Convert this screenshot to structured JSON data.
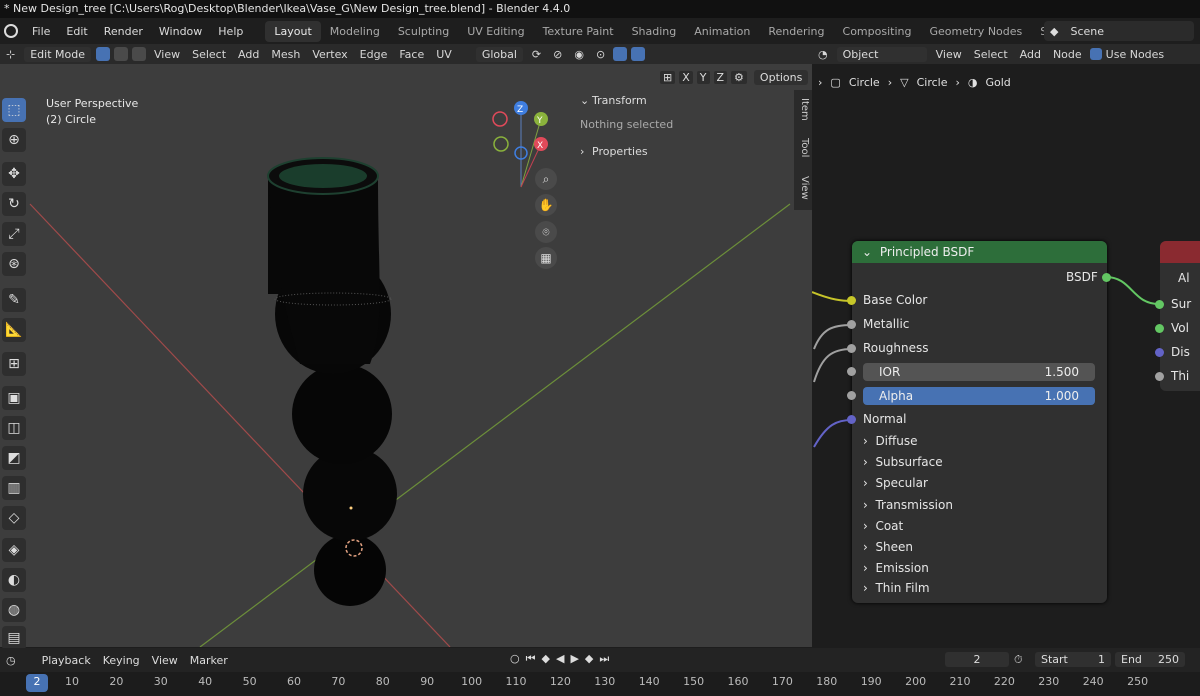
{
  "window": {
    "title": "* New Design_tree [C:\\Users\\Rog\\Desktop\\Blender\\Ikea\\Vase_G\\New Design_tree.blend] - Blender 4.4.0"
  },
  "menus": [
    "File",
    "Edit",
    "Render",
    "Window",
    "Help"
  ],
  "workspaces": [
    "Layout",
    "Modeling",
    "Sculpting",
    "UV Editing",
    "Texture Paint",
    "Shading",
    "Animation",
    "Rendering",
    "Compositing",
    "Geometry Nodes",
    "Scripting"
  ],
  "active_workspace": "Layout",
  "scene": {
    "label": "Scene"
  },
  "viewport_header": {
    "mode": "Edit Mode",
    "menus": [
      "View",
      "Select",
      "Add",
      "Mesh",
      "Vertex",
      "Edge",
      "Face",
      "UV"
    ],
    "transform_orientation": "Global",
    "options": "Options",
    "axes": [
      "X",
      "Y",
      "Z"
    ]
  },
  "viewport": {
    "perspective": "User Perspective",
    "object": "(2) Circle",
    "gizmo_axes": [
      "Z",
      "Y",
      "X"
    ]
  },
  "npanel": {
    "transform": "Transform",
    "nothing_selected": "Nothing selected",
    "properties": "Properties",
    "tabs": [
      "Item",
      "Tool",
      "View"
    ]
  },
  "node_header": {
    "object": "Object",
    "menus": [
      "View",
      "Select",
      "Add",
      "Node"
    ],
    "use_nodes": "Use Nodes"
  },
  "breadcrumb": [
    "Circle",
    "Circle",
    "Gold"
  ],
  "bsdf_node": {
    "title": "Principled BSDF",
    "output": "BSDF",
    "inputs": [
      "Base Color",
      "Metallic",
      "Roughness"
    ],
    "ior": {
      "label": "IOR",
      "value": "1.500"
    },
    "alpha": {
      "label": "Alpha",
      "value": "1.000"
    },
    "normal": "Normal",
    "panels": [
      "Diffuse",
      "Subsurface",
      "Specular",
      "Transmission",
      "Coat",
      "Sheen",
      "Emission",
      "Thin Film"
    ]
  },
  "output_node": {
    "title": "",
    "rows": [
      "Al",
      "Sur",
      "Vol",
      "Dis",
      "Thi"
    ]
  },
  "timeline": {
    "menus": [
      "Playback",
      "Keying",
      "View",
      "Marker"
    ],
    "current_frame": "2",
    "start_label": "Start",
    "start": "1",
    "end_label": "End",
    "end": "250",
    "ruler": [
      "2",
      "10",
      "20",
      "30",
      "40",
      "50",
      "60",
      "70",
      "80",
      "90",
      "100",
      "110",
      "120",
      "130",
      "140",
      "150",
      "160",
      "170",
      "180",
      "190",
      "200",
      "210",
      "220",
      "230",
      "240",
      "250"
    ]
  }
}
